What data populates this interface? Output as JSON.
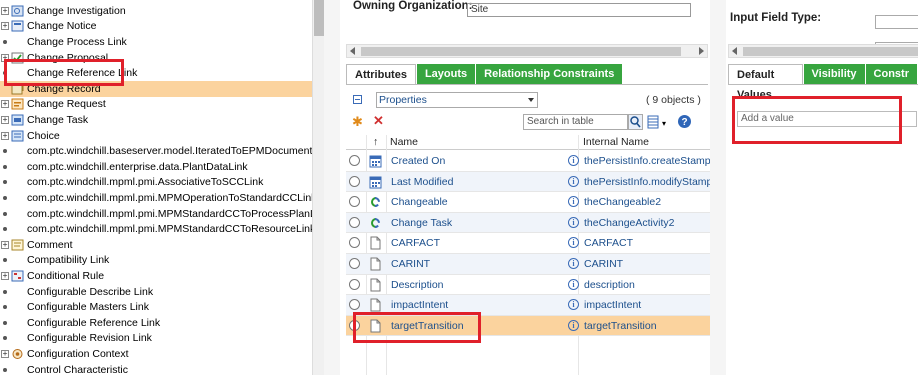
{
  "tree": {
    "items": [
      {
        "label": "Change Investigation",
        "icon": "change-investigation-icon",
        "expander": "+"
      },
      {
        "label": "Change Notice",
        "icon": "change-notice-icon",
        "expander": "+"
      },
      {
        "label": "Change Process Link",
        "icon": "",
        "expander": "bullet"
      },
      {
        "label": "Change Proposal",
        "icon": "change-proposal-icon",
        "expander": "+"
      },
      {
        "label": "Change Reference Link",
        "icon": "",
        "expander": "bullet"
      },
      {
        "label": "Change Record",
        "icon": "change-record-icon",
        "expander": "",
        "selected": true
      },
      {
        "label": "Change Request",
        "icon": "change-request-icon",
        "expander": "+"
      },
      {
        "label": "Change Task",
        "icon": "change-task-icon",
        "expander": "+"
      },
      {
        "label": "Choice",
        "icon": "choice-icon",
        "expander": "+"
      },
      {
        "label": "com.ptc.windchill.baseserver.model.IteratedToEPMDocumentLink",
        "icon": "",
        "expander": "bullet"
      },
      {
        "label": "com.ptc.windchill.enterprise.data.PlantDataLink",
        "icon": "",
        "expander": "bullet"
      },
      {
        "label": "com.ptc.windchill.mpml.pmi.AssociativeToSCCLink",
        "icon": "",
        "expander": "bullet"
      },
      {
        "label": "com.ptc.windchill.mpml.pmi.MPMOperationToStandardCCLink",
        "icon": "",
        "expander": "bullet"
      },
      {
        "label": "com.ptc.windchill.mpml.pmi.MPMStandardCCToProcessPlanLink",
        "icon": "",
        "expander": "bullet"
      },
      {
        "label": "com.ptc.windchill.mpml.pmi.MPMStandardCCToResourceLink",
        "icon": "",
        "expander": "bullet"
      },
      {
        "label": "Comment",
        "icon": "comment-icon",
        "expander": "+"
      },
      {
        "label": "Compatibility Link",
        "icon": "",
        "expander": "bullet"
      },
      {
        "label": "Conditional Rule",
        "icon": "conditional-rule-icon",
        "expander": "+"
      },
      {
        "label": "Configurable Describe Link",
        "icon": "",
        "expander": "bullet"
      },
      {
        "label": "Configurable Masters Link",
        "icon": "",
        "expander": "bullet"
      },
      {
        "label": "Configurable Reference Link",
        "icon": "",
        "expander": "bullet"
      },
      {
        "label": "Configurable Revision Link",
        "icon": "",
        "expander": "bullet"
      },
      {
        "label": "Configuration Context",
        "icon": "configuration-context-icon",
        "expander": "+"
      },
      {
        "label": "Control Characteristic",
        "icon": "",
        "expander": "bullet"
      }
    ]
  },
  "middle": {
    "owning_org_label": "Owning Organization:",
    "owning_org_value": "Site",
    "tabs": [
      {
        "label": "Attributes",
        "active": true
      },
      {
        "label": "Layouts",
        "active": false
      },
      {
        "label": "Relationship Constraints",
        "active": false
      }
    ],
    "view_select": "Properties",
    "object_count": "( 9 objects )",
    "search_placeholder": "Search in table",
    "columns": {
      "sort": "↑",
      "name": "Name",
      "internal": "Internal Name"
    },
    "rows": [
      {
        "name": "Created On",
        "internal": "thePersistInfo.createStamp",
        "icon": "calendar-icon"
      },
      {
        "name": "Last Modified",
        "internal": "thePersistInfo.modifyStamp",
        "icon": "calendar-icon"
      },
      {
        "name": "Changeable",
        "internal": "theChangeable2",
        "icon": "link-icon"
      },
      {
        "name": "Change Task",
        "internal": "theChangeActivity2",
        "icon": "link-icon"
      },
      {
        "name": "CARFACT",
        "internal": "CARFACT",
        "icon": "document-icon"
      },
      {
        "name": "CARINT",
        "internal": "CARINT",
        "icon": "document-icon"
      },
      {
        "name": "Description",
        "internal": "description",
        "icon": "document-icon"
      },
      {
        "name": "impactIntent",
        "internal": "impactIntent",
        "icon": "document-icon"
      },
      {
        "name": "targetTransition",
        "internal": "targetTransition",
        "icon": "document-icon",
        "selected": true
      }
    ]
  },
  "right": {
    "input_field_type_label": "Input Field Type:",
    "tabs": [
      {
        "label": "Default Values",
        "active": true
      },
      {
        "label": "Visibility",
        "active": false
      },
      {
        "label": "Constr",
        "active": false
      }
    ],
    "add_value_placeholder": "Add a value"
  },
  "colors": {
    "selected_row": "#fbd39e",
    "tab_green": "#37a53f",
    "link_blue": "#1c4f8c",
    "highlight_red": "#e0202a"
  }
}
